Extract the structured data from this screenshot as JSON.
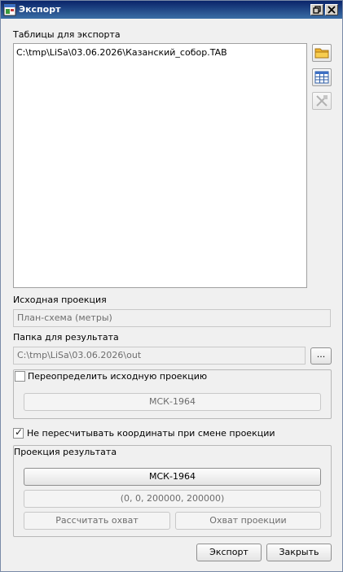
{
  "window": {
    "title": "Экспорт"
  },
  "tables": {
    "label": "Таблицы для экспорта",
    "items": [
      "C:\\tmp\\LiSa\\03.06.2026\\Казанский_собор.TAB"
    ]
  },
  "source_projection": {
    "label": "Исходная проекция",
    "value": "План-схема (метры)"
  },
  "output_folder": {
    "label": "Папка для результата",
    "value": "C:\\tmp\\LiSa\\03.06.2026\\out",
    "browse_label": "..."
  },
  "override_projection": {
    "label": "Переопределить исходную проекцию",
    "checked": false,
    "button": "МСК-1964"
  },
  "no_recalc": {
    "label": "Не пересчитывать координаты при смене проекции",
    "checked": true
  },
  "result_projection": {
    "label": "Проекция результата",
    "projection_button": "МСК-1964",
    "extent_value": "(0, 0, 200000, 200000)",
    "calc_extent_button": "Рассчитать охват",
    "projection_extent_button": "Охват проекции"
  },
  "buttons": {
    "export": "Экспорт",
    "close": "Закрыть"
  },
  "icons": {
    "titlebar": [
      "restore-icon",
      "close-icon"
    ],
    "side": [
      "folder-open-icon",
      "table-icon",
      "remove-icon"
    ]
  }
}
